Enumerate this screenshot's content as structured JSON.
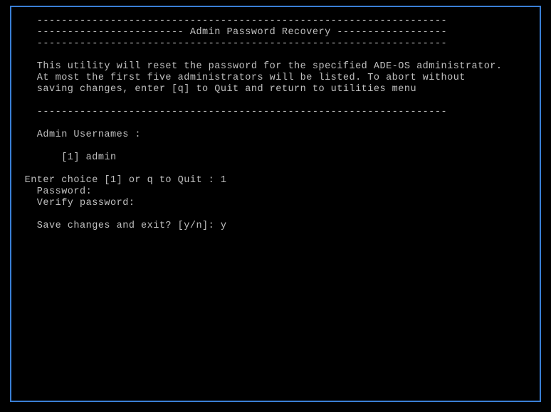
{
  "header": {
    "dash1": "   -------------------------------------------------------------------",
    "title": "   ------------------------ Admin Password Recovery ------------------",
    "dash2": "   -------------------------------------------------------------------"
  },
  "intro": {
    "l1": "   This utility will reset the password for the specified ADE-OS administrator.",
    "l2": "   At most the first five administrators will be listed. To abort without",
    "l3": "   saving changes, enter [q] to Quit and return to utilities menu"
  },
  "separator": "   -------------------------------------------------------------------",
  "usernames_label": "   Admin Usernames :",
  "usernames": {
    "item1": "       [1] admin"
  },
  "prompts": {
    "choice": " Enter choice [1] or q to Quit : 1",
    "password": "   Password:",
    "verify": "   Verify password:",
    "save": "   Save changes and exit? [y/n]: y"
  }
}
